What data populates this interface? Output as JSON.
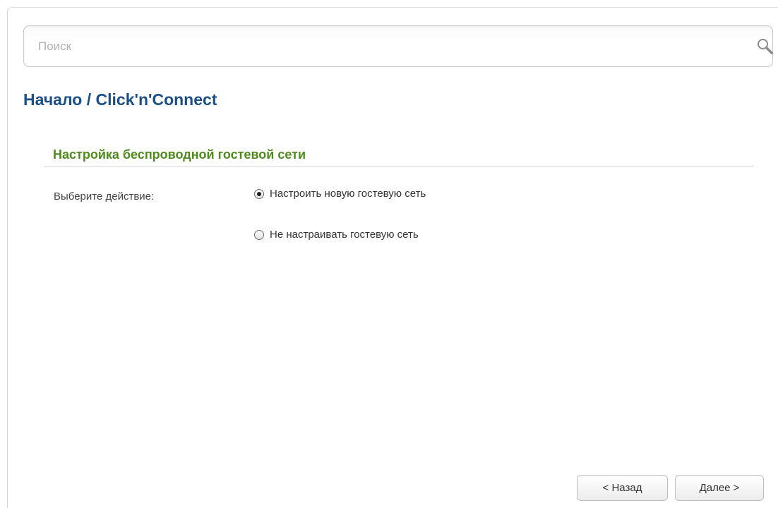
{
  "search": {
    "placeholder": "Поиск",
    "value": ""
  },
  "breadcrumb": {
    "root": "Начало",
    "separator": " / ",
    "current": "Click'n'Connect"
  },
  "section": {
    "title": "Настройка беспроводной гостевой сети"
  },
  "form": {
    "action_label": "Выберите действие:",
    "options": [
      {
        "label": "Настроить новую гостевую сеть",
        "checked": true
      },
      {
        "label": "Не настраивать гостевую сеть",
        "checked": false
      }
    ]
  },
  "buttons": {
    "back": "< Назад",
    "next": "Далее >"
  },
  "colors": {
    "title": "#1b4f86",
    "section_title": "#4e8b1c"
  },
  "icons": {
    "search": "search-icon"
  }
}
